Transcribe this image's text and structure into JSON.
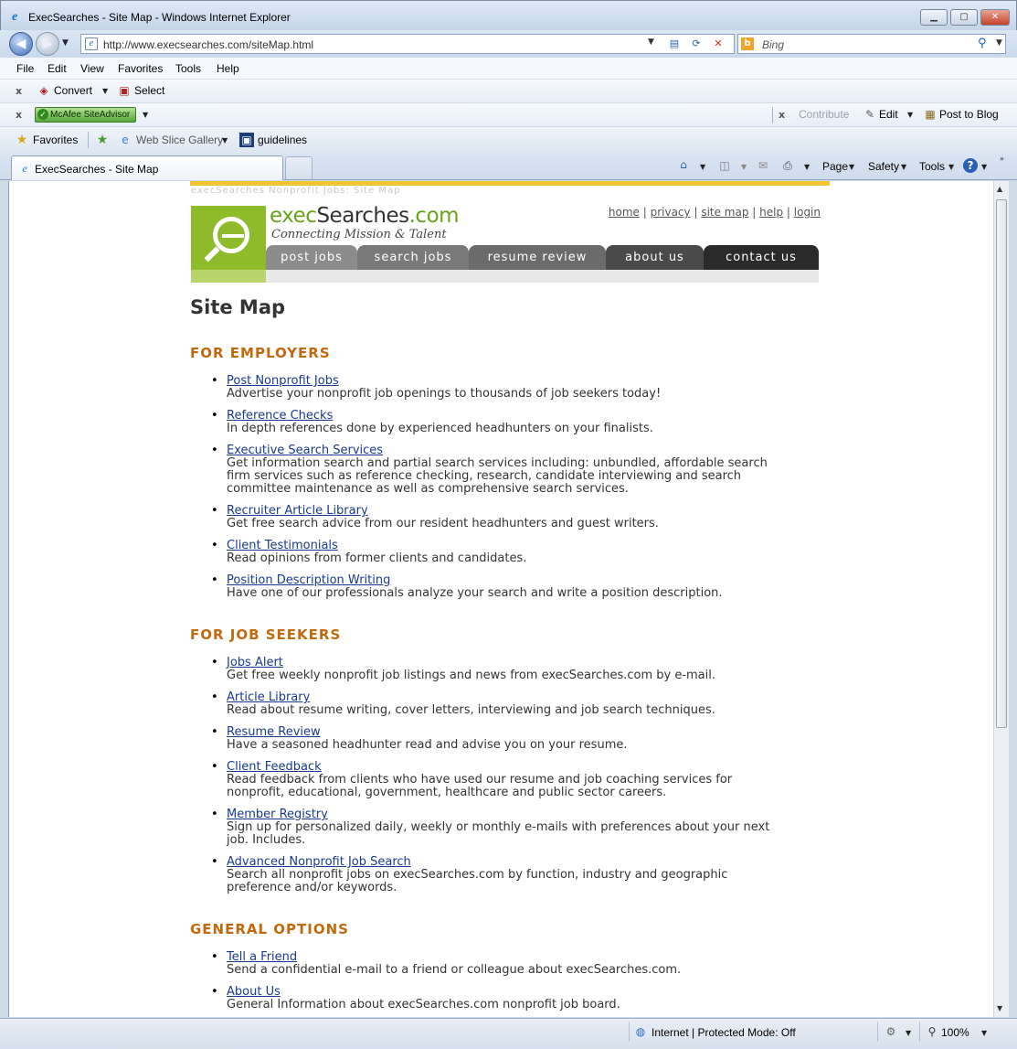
{
  "window": {
    "title": "ExecSearches - Site Map - Windows Internet Explorer",
    "minimize": "▁",
    "maximize": "▢",
    "close": "✕"
  },
  "address": {
    "url": "http://www.execsearches.com/siteMap.html",
    "search_placeholder": "Bing"
  },
  "menu": [
    "File",
    "Edit",
    "View",
    "Favorites",
    "Tools",
    "Help"
  ],
  "toolbar1": {
    "convert": "Convert",
    "select": "Select"
  },
  "toolbar2": {
    "mcafee": "McAfee SiteAdvisor",
    "contribute": "Contribute",
    "edit": "Edit",
    "post_to_blog": "Post to Blog"
  },
  "favbar": {
    "favorites": "Favorites",
    "web_slice": "Web Slice Gallery",
    "guidelines": "guidelines"
  },
  "tab": {
    "title": "ExecSearches - Site Map"
  },
  "commandbar": {
    "page": "Page",
    "safety": "Safety",
    "tools": "Tools"
  },
  "site": {
    "tagline_top": "execSearches Nonprofit Jobs: Site Map",
    "brand_main": "exec",
    "brand_rest": "Searches",
    "brand_tld": ".com",
    "brand_sub": "Connecting Mission & Talent",
    "top_links": [
      "home",
      "privacy",
      "site map",
      "help",
      "login"
    ],
    "nav": [
      {
        "label": "post jobs",
        "color": "#8c8c8c"
      },
      {
        "label": "search jobs",
        "color": "#7a7a7a"
      },
      {
        "label": "resume review",
        "color": "#6b6b6b"
      },
      {
        "label": "about us",
        "color": "#4a4a4a"
      },
      {
        "label": "contact us",
        "color": "#2a2a2a"
      }
    ]
  },
  "page_title": "Site Map",
  "sections": [
    {
      "heading": "FOR EMPLOYERS",
      "items": [
        {
          "link": "Post Nonprofit Jobs",
          "desc": "Advertise your nonprofit job openings to thousands of job seekers today!"
        },
        {
          "link": "Reference Checks",
          "desc": "In depth references done by experienced headhunters on your finalists."
        },
        {
          "link": "Executive Search Services",
          "desc": "Get information search and partial search services including: unbundled, affordable search firm services such as reference checking, research, candidate interviewing and search committee maintenance as well as comprehensive search services."
        },
        {
          "link": "Recruiter Article Library",
          "desc": "Get free search advice from our resident headhunters and guest writers."
        },
        {
          "link": "Client Testimonials",
          "desc": "Read opinions from former clients and candidates."
        },
        {
          "link": "Position Description Writing",
          "desc": "Have one of our professionals analyze your search and write a position description."
        }
      ]
    },
    {
      "heading": "FOR JOB SEEKERS",
      "items": [
        {
          "link": "Jobs Alert",
          "desc": "Get free weekly nonprofit job listings and news from execSearches.com by e-mail."
        },
        {
          "link": "Article Library",
          "desc": "Read about resume writing, cover letters, interviewing and job search techniques."
        },
        {
          "link": "Resume Review",
          "desc": "Have a seasoned headhunter read and advise you on your resume."
        },
        {
          "link": "Client Feedback",
          "desc": "Read feedback from clients who have used our resume and job coaching services for nonprofit, educational, government, healthcare and public sector careers."
        },
        {
          "link": "Member Registry",
          "desc": "Sign up for personalized daily, weekly or monthly e-mails with preferences about your next job. Includes."
        },
        {
          "link": "Advanced Nonprofit Job Search",
          "desc": "Search all nonprofit jobs on execSearches.com by function, industry and geographic preference and/or keywords."
        }
      ]
    },
    {
      "heading": "GENERAL OPTIONS",
      "items": [
        {
          "link": "Tell a Friend",
          "desc": "Send a confidential e-mail to a friend or colleague about execSearches.com."
        },
        {
          "link": "About Us",
          "desc": "General Information about execSearches.com nonprofit job board."
        }
      ]
    }
  ],
  "status": {
    "zone": "Internet | Protected Mode: Off",
    "zoom": "100%"
  }
}
